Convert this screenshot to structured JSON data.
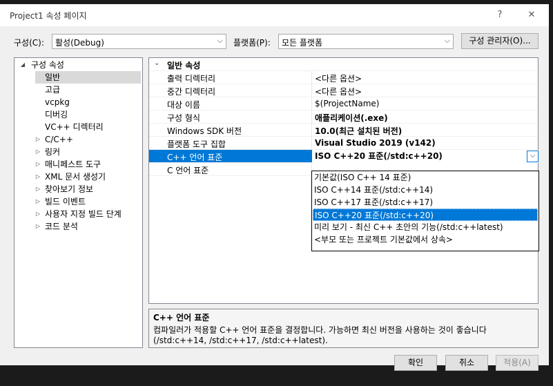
{
  "window": {
    "title": "Project1 속성 페이지",
    "help": "?",
    "close": "✕"
  },
  "config": {
    "config_label": "구성(C):",
    "config_value": "활성(Debug)",
    "platform_label": "플랫폼(P):",
    "platform_value": "모든 플랫폼",
    "manager_button": "구성 관리자(O)..."
  },
  "tree": {
    "root": "구성 속성",
    "items": [
      "일반",
      "고급",
      "vcpkg",
      "디버깅",
      "VC++ 디렉터리",
      "C/C++",
      "링커",
      "매니페스트 도구",
      "XML 문서 생성기",
      "찾아보기 정보",
      "빌드 이벤트",
      "사용자 지정 빌드 단계",
      "코드 분석"
    ]
  },
  "grid": {
    "section": "일반 속성",
    "rows": [
      {
        "name": "출력 디렉터리",
        "value": "<다른 옵션>"
      },
      {
        "name": "중간 디렉터리",
        "value": "<다른 옵션>"
      },
      {
        "name": "대상 이름",
        "value": "$(ProjectName)"
      },
      {
        "name": "구성 형식",
        "value": "애플리케이션(.exe)"
      },
      {
        "name": "Windows SDK 버전",
        "value": "10.0(최근 설치된 버전)"
      },
      {
        "name": "플랫폼 도구 집합",
        "value": "Visual Studio 2019 (v142)"
      },
      {
        "name": "C++ 언어 표준",
        "value": "ISO C++20 표준(/std:c++20)"
      },
      {
        "name": "C 언어 표준",
        "value": ""
      }
    ]
  },
  "dropdown": {
    "options": [
      "기본값(ISO C++ 14 표준)",
      "ISO C++14 표준(/std:c++14)",
      "ISO C++17 표준(/std:c++17)",
      "ISO C++20 표준(/std:c++20)",
      "미리 보기 - 최신 C++ 초안의 기능(/std:c++latest)",
      "<부모 또는 프로젝트 기본값에서 상속>"
    ],
    "selected_index": 3
  },
  "description": {
    "title": "C++ 언어 표준",
    "line1": "컴파일러가 적용할 C++ 언어 표준을 결정합니다. 가능하면 최신 버전을 사용하는 것이 좋습니다",
    "line2": "(/std:c++14, /std:c++17, /std:c++latest)."
  },
  "buttons": {
    "ok": "확인",
    "cancel": "취소",
    "apply": "적용(A)"
  }
}
